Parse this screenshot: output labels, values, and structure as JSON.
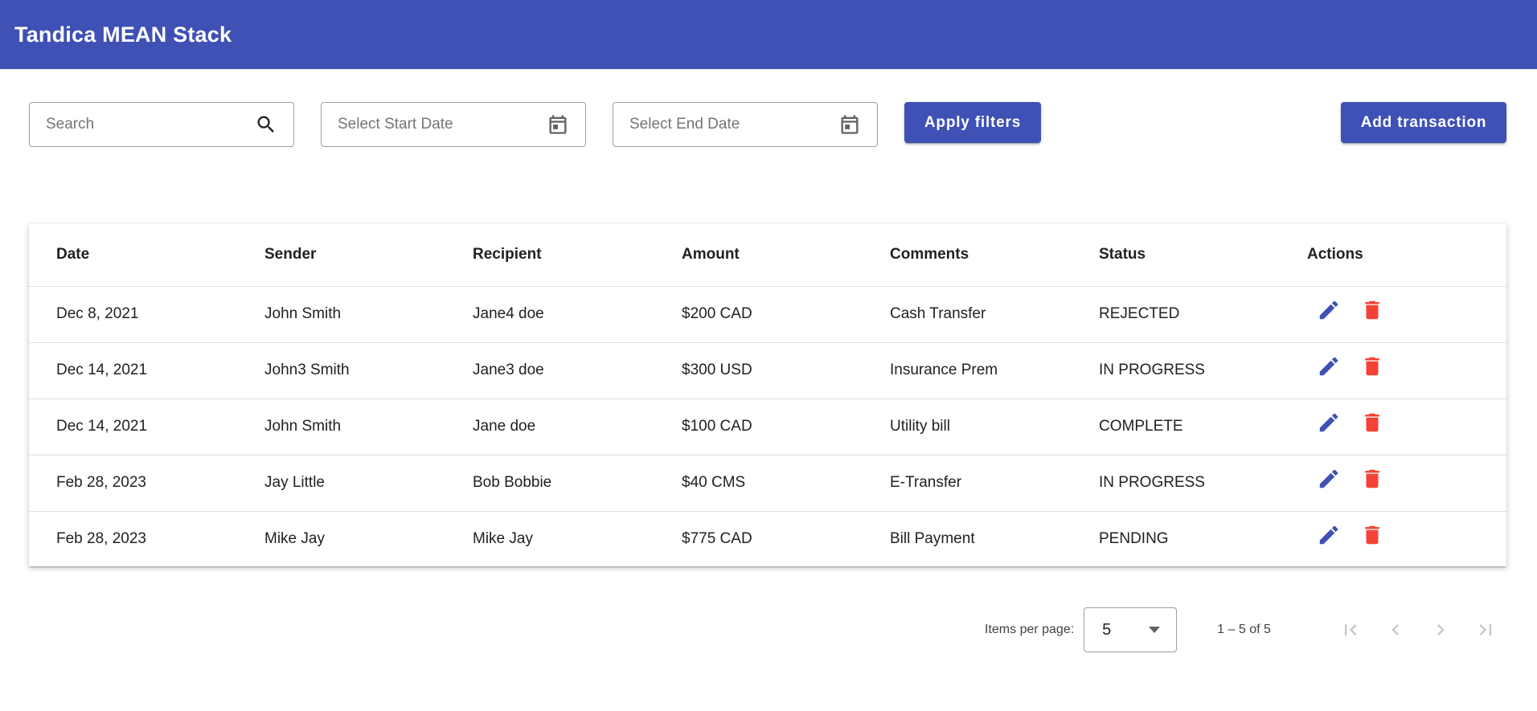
{
  "app": {
    "title": "Tandica MEAN Stack"
  },
  "filters": {
    "search_placeholder": "Search",
    "start_date_placeholder": "Select Start Date",
    "end_date_placeholder": "Select End Date",
    "apply_label": "Apply filters",
    "add_label": "Add transaction"
  },
  "table": {
    "headers": [
      "Date",
      "Sender",
      "Recipient",
      "Amount",
      "Comments",
      "Status",
      "Actions"
    ],
    "rows": [
      {
        "date": "Dec 8, 2021",
        "sender": "John Smith",
        "recipient": "Jane4 doe",
        "amount": "$200 CAD",
        "comments": "Cash Transfer",
        "status": "REJECTED"
      },
      {
        "date": "Dec 14, 2021",
        "sender": "John3 Smith",
        "recipient": "Jane3 doe",
        "amount": "$300 USD",
        "comments": "Insurance Prem",
        "status": "IN PROGRESS"
      },
      {
        "date": "Dec 14, 2021",
        "sender": "John Smith",
        "recipient": "Jane doe",
        "amount": "$100 CAD",
        "comments": "Utility bill",
        "status": "COMPLETE"
      },
      {
        "date": "Feb 28, 2023",
        "sender": "Jay Little",
        "recipient": "Bob Bobbie",
        "amount": "$40 CMS",
        "comments": "E-Transfer",
        "status": "IN PROGRESS"
      },
      {
        "date": "Feb 28, 2023",
        "sender": "Mike Jay",
        "recipient": "Mike Jay",
        "amount": "$775 CAD",
        "comments": "Bill Payment",
        "status": "PENDING"
      }
    ],
    "row_actions": [
      "edit-icon",
      "delete-icon"
    ]
  },
  "paginator": {
    "items_per_page_label": "Items per page:",
    "page_size": "5",
    "range_label": "1 – 5 of 5",
    "nav_icons": [
      "first-page-icon",
      "previous-page-icon",
      "next-page-icon",
      "last-page-icon"
    ]
  },
  "colors": {
    "primary": "#3f51b5",
    "edit_icon": "#3f51b5",
    "delete_icon": "#f44336",
    "disabled_icon": "#c6c6c6"
  }
}
